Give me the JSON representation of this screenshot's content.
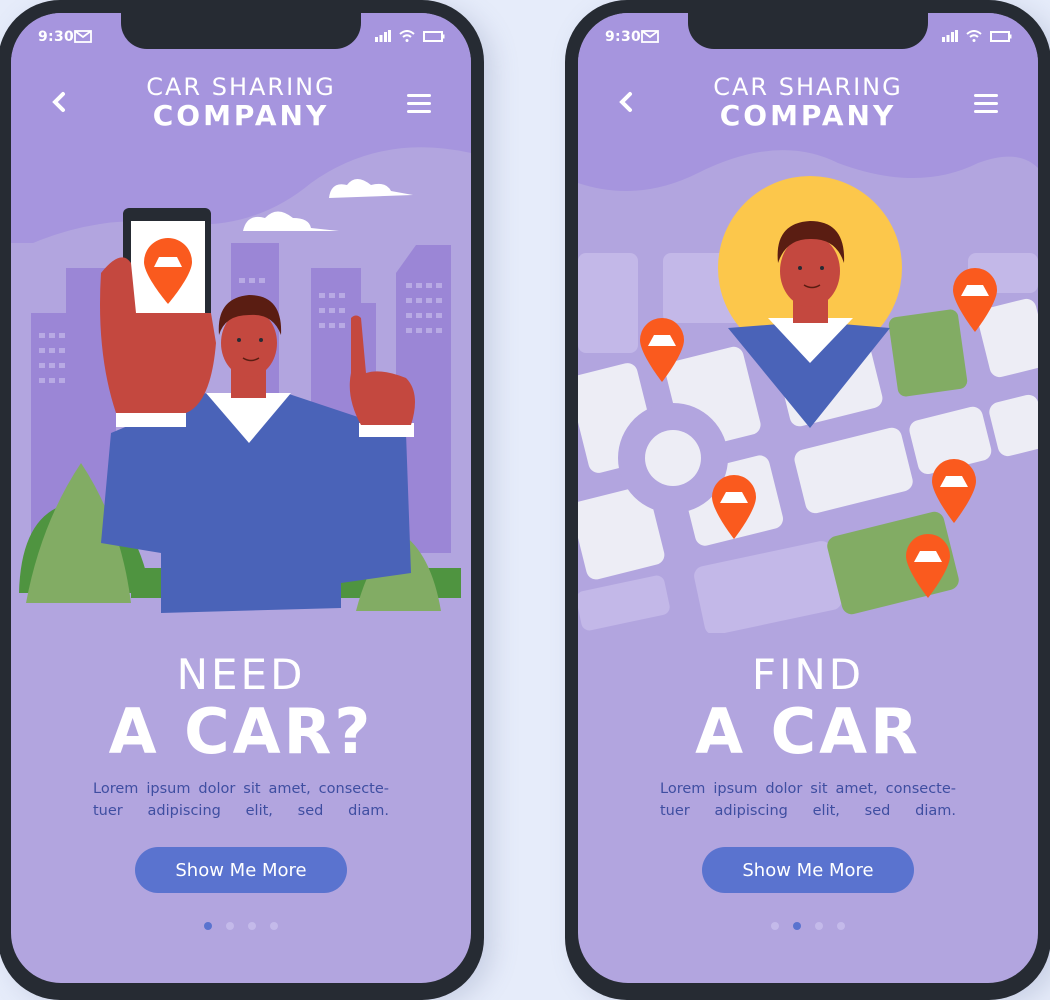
{
  "colors": {
    "page_background": "#e6ecfa",
    "phone_frame": "#262b33",
    "screen_background": "#b2a5df",
    "screen_top": "#a695de",
    "accent_button": "#5a73cf",
    "body_text": "#3f4ea1",
    "pin_orange": "#fa5a1e",
    "sweater_blue": "#4a63b8",
    "skin": "#c4483f",
    "hair": "#5a1d12",
    "plant_green": "#82ac64",
    "plant_dark": "#4f9440",
    "avatar_yellow": "#fcc74b",
    "map_block": "#ededf5"
  },
  "screens": [
    {
      "status": {
        "time": "9:30",
        "icons": [
          "mail-icon",
          "signal-icon",
          "wifi-icon",
          "battery-icon"
        ]
      },
      "header": {
        "back_icon": "chevron-left-icon",
        "title_line1": "CAR SHARING",
        "title_line2": "COMPANY",
        "menu_icon": "hamburger-menu-icon"
      },
      "illustration": "man-holding-phone-with-car-pin-in-city",
      "headline_small": "NEED",
      "headline_big": "A CAR?",
      "body": "Lorem ipsum dolor sit amet, consecte-tuer adipiscing elit, sed diam.",
      "button_label": "Show Me More",
      "pager": {
        "total": 4,
        "active": 1
      }
    },
    {
      "status": {
        "time": "9:30",
        "icons": [
          "mail-icon",
          "signal-icon",
          "wifi-icon",
          "battery-icon"
        ]
      },
      "header": {
        "back_icon": "chevron-left-icon",
        "title_line1": "CAR SHARING",
        "title_line2": "COMPANY",
        "menu_icon": "hamburger-menu-icon"
      },
      "illustration": "city-map-with-user-avatar-pin-and-car-pins",
      "headline_small": "FIND",
      "headline_big": "A CAR",
      "body": "Lorem ipsum dolor sit amet, consecte-tuer adipiscing elit, sed diam.",
      "button_label": "Show Me More",
      "pager": {
        "total": 4,
        "active": 2
      }
    }
  ]
}
